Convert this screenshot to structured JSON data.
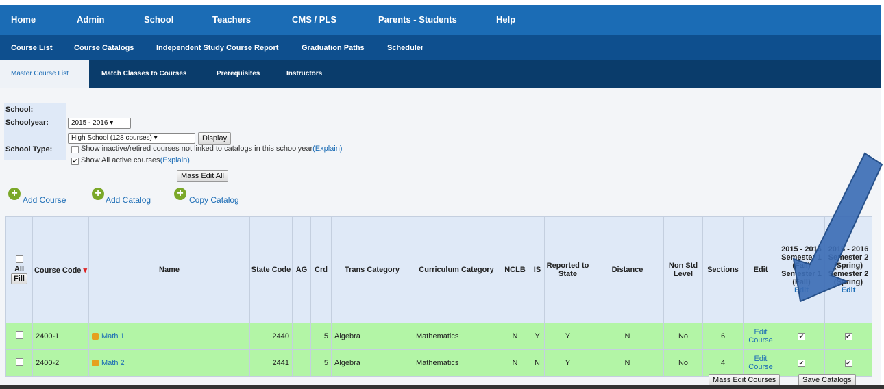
{
  "nav_primary": [
    "Home",
    "Admin",
    "School",
    "Teachers",
    "CMS / PLS",
    "Parents - Students",
    "Help"
  ],
  "nav_secondary": [
    "Course List",
    "Course Catalogs",
    "Independent Study Course Report",
    "Graduation Paths",
    "Scheduler"
  ],
  "nav_tertiary": {
    "active": "Master Course List",
    "items": [
      "Match Classes to Courses",
      "Prerequisites",
      "Instructors"
    ]
  },
  "filters": {
    "school_label": "School:",
    "schoolyear_label": "Schoolyear:",
    "schoolyear_value": "2015 - 2016",
    "school_type_label": "School Type:",
    "school_type_value": "High School  (128 courses)",
    "display_button": "Display",
    "show_inactive_text": "Show inactive/retired courses not linked to catalogs in this schoolyear",
    "show_active_text": "Show All active courses",
    "explain_link": "(Explain)",
    "mass_edit_all": "Mass Edit All"
  },
  "actions": {
    "add_course": "Add Course",
    "add_catalog": "Add Catalog",
    "copy_catalog": "Copy Catalog"
  },
  "table": {
    "headers": {
      "all": "All",
      "fill": "Fill",
      "course_code": "Course Code",
      "sort_mark": "▾",
      "name": "Name",
      "state_code": "State Code",
      "ag": "AG",
      "crd": "Crd",
      "trans_category": "Trans Category",
      "curriculum_category": "Curriculum Category",
      "nclb": "NCLB",
      "is": "IS",
      "reported": "Reported to State",
      "distance": "Distance",
      "non_std_level": "Non Std Level",
      "sections": "Sections",
      "edit": "Edit",
      "sem1": "2015 - 2016 Semester 1 (Fall) Semester 1 (Fall)",
      "sem1_edit": "Edit",
      "sem2": "2015 - 2016 Semester 2 (Spring) Semester 2 (Spring)",
      "sem2_edit": "Edit"
    },
    "rows": [
      {
        "code": "2400-1",
        "name": "Math 1",
        "state_code": "2440",
        "ag": "",
        "crd": "5",
        "trans": "Algebra",
        "curriculum": "Mathematics",
        "nclb": "N",
        "is": "Y",
        "reported": "Y",
        "distance": "N",
        "nonstd": "No",
        "sections": "6",
        "edit": "Edit Course"
      },
      {
        "code": "2400-2",
        "name": "Math 2",
        "state_code": "2441",
        "ag": "",
        "crd": "5",
        "trans": "Algebra",
        "curriculum": "Mathematics",
        "nclb": "N",
        "is": "N",
        "reported": "Y",
        "distance": "N",
        "nonstd": "No",
        "sections": "4",
        "edit": "Edit Course"
      }
    ]
  },
  "footer_buttons": {
    "mass_edit_courses": "Mass Edit Courses",
    "save_catalogs": "Save Catalogs"
  },
  "colors": {
    "nav_primary": "#1b6cb5",
    "nav_secondary": "#0e4f8e",
    "nav_tertiary": "#0a3c6b",
    "row_green": "#b3f5a6",
    "header_bg": "#dfe9f7",
    "arrow": "#3d6eb5"
  }
}
